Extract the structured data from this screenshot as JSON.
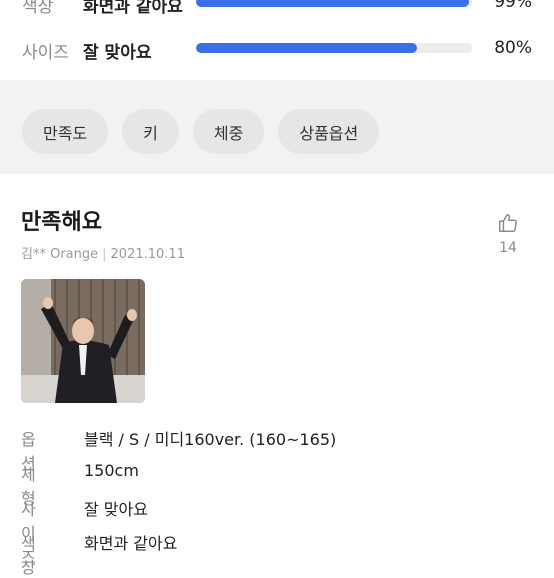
{
  "ratings": [
    {
      "label": "색상",
      "value": "화면과 같아요",
      "fraction": 0.99,
      "percent": "99%"
    },
    {
      "label": "사이즈",
      "value": "잘 맞아요",
      "fraction": 0.8,
      "percent": "80%"
    }
  ],
  "filters": [
    {
      "label": "만족도"
    },
    {
      "label": "키"
    },
    {
      "label": "체중"
    },
    {
      "label": "상품옵션"
    }
  ],
  "review": {
    "title": "만족해요",
    "author": "김** Orange",
    "date": "2021.10.11",
    "likes": "14",
    "details": [
      {
        "label": "옵션",
        "value": "블랙 / S / 미디160ver. (160~165)"
      },
      {
        "label": "체형",
        "value": "150cm"
      },
      {
        "label": "사이즈",
        "value": "잘 맞아요"
      },
      {
        "label": "색상",
        "value": "화면과 같아요"
      }
    ]
  },
  "colors": {
    "accent": "#3b6fe8",
    "track": "#ececec",
    "chip_bg": "#e6e6e6",
    "band_bg": "#f2f2f2"
  }
}
